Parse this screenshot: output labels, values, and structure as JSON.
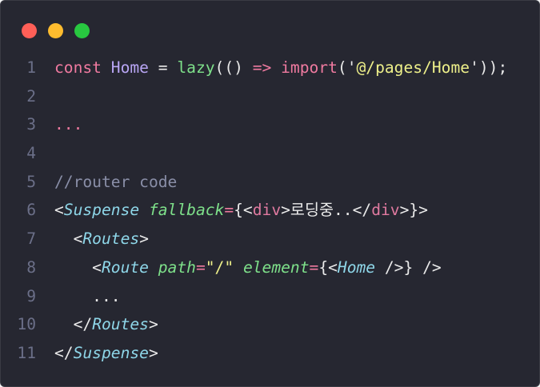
{
  "window_controls": {
    "close_color": "#ff5f57",
    "minimize_color": "#febc2e",
    "maximize_color": "#28c840"
  },
  "code_lines": [
    {
      "number": "1",
      "tokens": [
        [
          "const ",
          "kw"
        ],
        [
          "Home",
          "id"
        ],
        [
          " = ",
          "p"
        ],
        [
          "lazy",
          "fn"
        ],
        [
          "(() ",
          "p"
        ],
        [
          "=>",
          "op"
        ],
        [
          " ",
          "p"
        ],
        [
          "import",
          "kw"
        ],
        [
          "('",
          "p"
        ],
        [
          "@/pages/Home",
          "str"
        ],
        [
          "'));",
          "p"
        ]
      ]
    },
    {
      "number": "2",
      "tokens": []
    },
    {
      "number": "3",
      "tokens": [
        [
          "...",
          "kw"
        ]
      ]
    },
    {
      "number": "4",
      "tokens": []
    },
    {
      "number": "5",
      "tokens": [
        [
          "//router code",
          "cm"
        ]
      ]
    },
    {
      "number": "6",
      "tokens": [
        [
          "<",
          "p"
        ],
        [
          "Suspense",
          "tag"
        ],
        [
          " ",
          "p"
        ],
        [
          "fallback",
          "attr"
        ],
        [
          "=",
          "op"
        ],
        [
          "{<",
          "p"
        ],
        [
          "div",
          "html"
        ],
        [
          ">",
          "p"
        ],
        [
          "로딩중..",
          "txt"
        ],
        [
          "</",
          "p"
        ],
        [
          "div",
          "html"
        ],
        [
          ">}>",
          "p"
        ]
      ]
    },
    {
      "number": "7",
      "tokens": [
        [
          "  <",
          "p"
        ],
        [
          "Routes",
          "tag"
        ],
        [
          ">",
          "p"
        ]
      ]
    },
    {
      "number": "8",
      "tokens": [
        [
          "    <",
          "p"
        ],
        [
          "Route",
          "tag"
        ],
        [
          " ",
          "p"
        ],
        [
          "path",
          "attr"
        ],
        [
          "=",
          "op"
        ],
        [
          "\"/\"",
          "str"
        ],
        [
          " ",
          "p"
        ],
        [
          "element",
          "attr"
        ],
        [
          "=",
          "op"
        ],
        [
          "{<",
          "p"
        ],
        [
          "Home",
          "tag"
        ],
        [
          " />} />",
          "p"
        ]
      ]
    },
    {
      "number": "9",
      "tokens": [
        [
          "    ...",
          "p"
        ]
      ]
    },
    {
      "number": "10",
      "tokens": [
        [
          "  </",
          "p"
        ],
        [
          "Routes",
          "tag"
        ],
        [
          ">",
          "p"
        ]
      ]
    },
    {
      "number": "11",
      "tokens": [
        [
          "</",
          "p"
        ],
        [
          "Suspense",
          "tag"
        ],
        [
          ">",
          "p"
        ]
      ]
    }
  ]
}
